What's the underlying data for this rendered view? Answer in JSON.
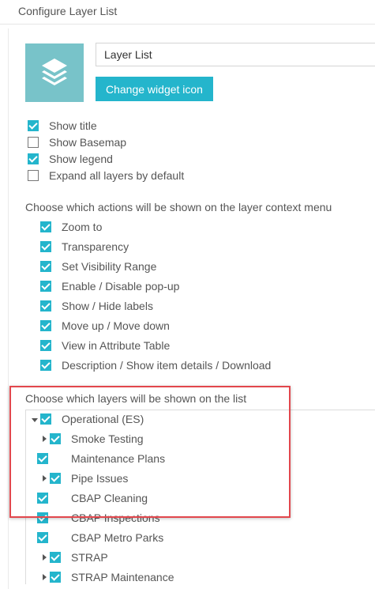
{
  "header": {
    "title": "Configure Layer List"
  },
  "widget": {
    "name": "Layer List",
    "change_icon_label": "Change widget icon",
    "icon": "layers-icon",
    "tile_color": "#78c3c9"
  },
  "options": [
    {
      "label": "Show title",
      "checked": true
    },
    {
      "label": "Show Basemap",
      "checked": false
    },
    {
      "label": "Show legend",
      "checked": true
    },
    {
      "label": "Expand all layers by default",
      "checked": false
    }
  ],
  "actions": {
    "heading": "Choose which actions will be shown on the layer context menu",
    "items": [
      {
        "label": "Zoom to",
        "checked": true
      },
      {
        "label": "Transparency",
        "checked": true
      },
      {
        "label": "Set Visibility Range",
        "checked": true
      },
      {
        "label": "Enable / Disable pop-up",
        "checked": true
      },
      {
        "label": "Show / Hide labels",
        "checked": true
      },
      {
        "label": "Move up / Move down",
        "checked": true
      },
      {
        "label": "View in Attribute Table",
        "checked": true
      },
      {
        "label": "Description / Show item details / Download",
        "checked": true
      }
    ]
  },
  "layers": {
    "heading": "Choose which layers will be shown on the list",
    "items": [
      {
        "label": "Operational (ES)",
        "checked": true,
        "expander": "expanded",
        "level": 0
      },
      {
        "label": "Smoke Testing",
        "checked": true,
        "expander": "collapsed",
        "level": 1
      },
      {
        "label": "Maintenance Plans",
        "checked": true,
        "expander": "none",
        "level": 1
      },
      {
        "label": "Pipe Issues",
        "checked": true,
        "expander": "collapsed",
        "level": 1
      },
      {
        "label": "CBAP Cleaning",
        "checked": true,
        "expander": "none",
        "level": 1
      },
      {
        "label": "CBAP Inspections",
        "checked": true,
        "expander": "none",
        "level": 1
      },
      {
        "label": "CBAP Metro Parks",
        "checked": true,
        "expander": "none",
        "level": 1
      },
      {
        "label": "STRAP",
        "checked": true,
        "expander": "collapsed",
        "level": 1
      },
      {
        "label": "STRAP Maintenance",
        "checked": true,
        "expander": "collapsed",
        "level": 1
      }
    ]
  },
  "colors": {
    "accent": "#24b5cc",
    "highlight_border": "#e2474d"
  }
}
